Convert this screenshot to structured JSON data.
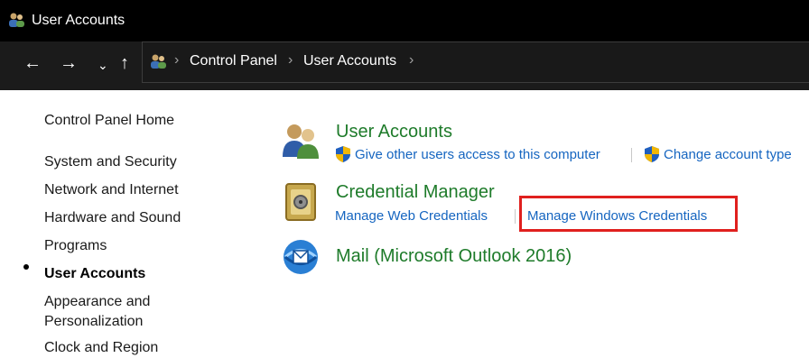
{
  "window": {
    "title": "User Accounts"
  },
  "nav": {
    "back_icon": "back-arrow-icon",
    "forward_icon": "forward-arrow-icon",
    "recent_icon": "chevron-down-icon",
    "up_icon": "up-arrow-icon",
    "breadcrumbs": [
      "Control Panel",
      "User Accounts"
    ]
  },
  "sidebar": {
    "home": "Control Panel Home",
    "items": [
      "System and Security",
      "Network and Internet",
      "Hardware and Sound",
      "Programs",
      "User Accounts",
      "Appearance and",
      "Personalization",
      "Clock and Region"
    ],
    "current": "User Accounts"
  },
  "categories": [
    {
      "title": "User Accounts",
      "icon": "users-icon",
      "tasks": [
        {
          "label": "Give other users access to this computer",
          "shield": true
        },
        {
          "label": "Change account type",
          "shield": true
        }
      ]
    },
    {
      "title": "Credential Manager",
      "icon": "credential-vault-icon",
      "tasks": [
        {
          "label": "Manage Web Credentials",
          "shield": false
        },
        {
          "label": "Manage Windows Credentials",
          "shield": false
        }
      ]
    },
    {
      "title": "Mail (Microsoft Outlook 2016)",
      "icon": "mail-icon",
      "tasks": []
    }
  ],
  "colors": {
    "category_title": "#1e7b2a",
    "link": "#1565c0",
    "highlight_box": "#e0201e",
    "titlebar": "#000000",
    "navbar": "#1b1b1b"
  }
}
